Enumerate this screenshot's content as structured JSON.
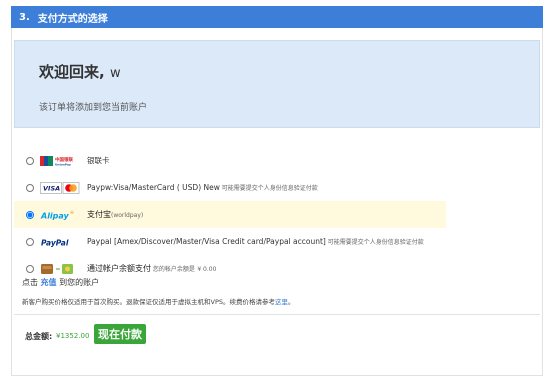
{
  "section": {
    "number": "3.",
    "title": "支付方式的选择"
  },
  "welcome": {
    "title": "欢迎回来,",
    "user": "w",
    "subtitle": "该订单将添加到您当前账户"
  },
  "payment_methods": [
    {
      "logo_text": "中国银联",
      "label": "银联卡",
      "note": "",
      "selected": false
    },
    {
      "logo_text": "VISA",
      "label": "Paypw:Visa/MasterCard ( USD) New",
      "note": " 可能需要提交个人身份信息验证付款",
      "selected": false
    },
    {
      "logo_text": "Alipay",
      "label": "支付宝",
      "note": "(worldpay)",
      "selected": true
    },
    {
      "logo_text": "PayPal",
      "label": "Paypal [Amex/Discover/Master/Visa Credit card/Paypal account]",
      "note": " 可能需要提交个人身份信息验证付款",
      "selected": false
    },
    {
      "logo_text": "",
      "label": "通过帐户余额支付",
      "note": " 您的帐户余额是",
      "balance": "¥ 0.00",
      "selected": false
    }
  ],
  "recharge": {
    "prefix": "点击 ",
    "link": "充值",
    "suffix": " 到您的账户"
  },
  "notice": {
    "text": "新客户购买价格仅适用于首次购买。退款保证仅适用于虚拟主机和VPS。续费价格请参考",
    "link": "这里",
    "end": "。"
  },
  "total": {
    "label": "总金额:",
    "value": "¥1352.00"
  },
  "pay_button": "现在付款",
  "colors": {
    "header": "#3d7fd8",
    "welcome_bg": "#dbe9f9",
    "selected_bg": "#fff9dd",
    "pay_button": "#3aa63a"
  }
}
